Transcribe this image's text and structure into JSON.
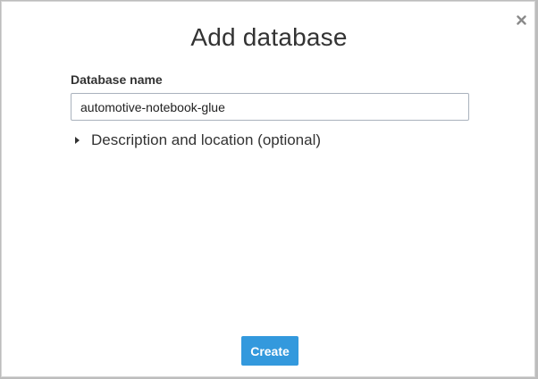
{
  "dialog": {
    "title": "Add database",
    "close_icon": "close-icon"
  },
  "database_name": {
    "label": "Database name",
    "value": "automotive-notebook-glue"
  },
  "description_section": {
    "label": "Description and location (optional)",
    "expanded": false,
    "icon": "caret-right-icon"
  },
  "actions": {
    "create_label": "Create"
  },
  "colors": {
    "primary_button": "#3399dd",
    "text": "#333333",
    "input_border": "#aab2bd"
  }
}
